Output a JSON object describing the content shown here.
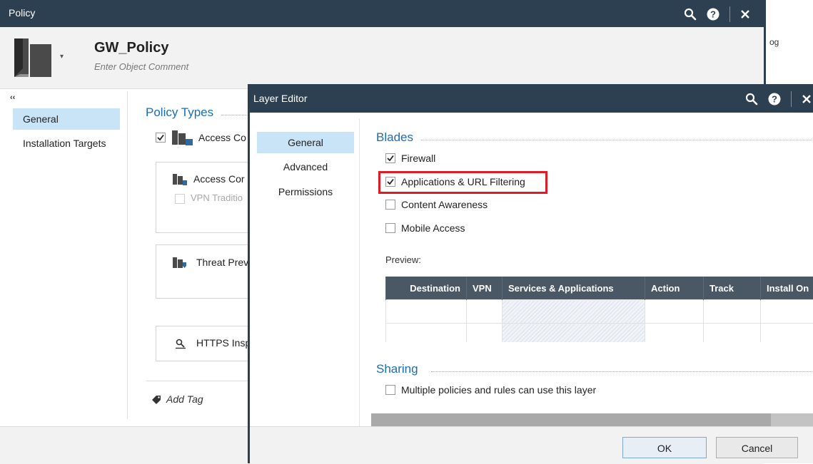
{
  "background": {
    "fragment": "og"
  },
  "policy_window": {
    "title": "Policy",
    "object_name": "GW_Policy",
    "object_comment": "Enter Object Comment",
    "nav": [
      {
        "label": "General",
        "active": true
      },
      {
        "label": "Installation Targets",
        "active": false
      }
    ],
    "policy_types_title": "Policy Types",
    "access_control_checked": true,
    "access_control_label": "Access Co",
    "access_card_label": "Access Cor",
    "vpn_label": "VPN Traditio",
    "threat_label": "Threat Prev",
    "https_label": "HTTPS Insp",
    "add_tag": "Add Tag"
  },
  "layer_editor": {
    "title": "Layer Editor",
    "nav": [
      {
        "label": "General",
        "active": true
      },
      {
        "label": "Advanced",
        "active": false
      },
      {
        "label": "Permissions",
        "active": false
      }
    ],
    "blades_title": "Blades",
    "blades": [
      {
        "label": "Firewall",
        "checked": true
      },
      {
        "label": "Applications & URL Filtering",
        "checked": true,
        "highlighted": true
      },
      {
        "label": "Content Awareness",
        "checked": false
      },
      {
        "label": "Mobile Access",
        "checked": false
      }
    ],
    "preview_label": "Preview:",
    "preview_columns": [
      "Destination",
      "VPN",
      "Services & Applications",
      "Action",
      "Track",
      "Install On"
    ],
    "sharing_title": "Sharing",
    "sharing_option": {
      "label": "Multiple policies and rules can use this layer",
      "checked": false
    },
    "ok_label": "OK",
    "cancel_label": "Cancel"
  },
  "colors": {
    "titlebar": "#2d4052",
    "accent": "#1a6db6",
    "highlight": "#e01b24",
    "nav_active": "#c9e3f7"
  }
}
